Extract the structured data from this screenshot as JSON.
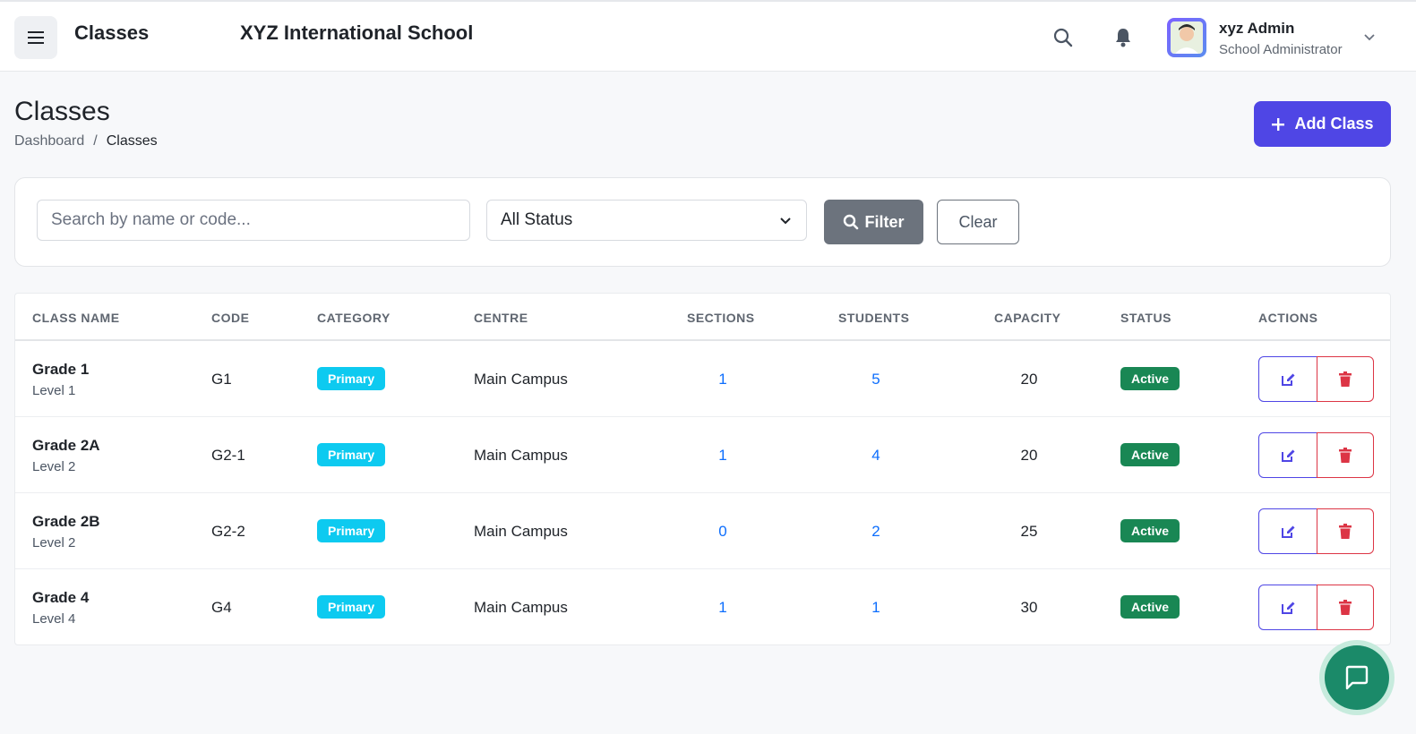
{
  "header": {
    "title": "Classes",
    "school_name": "XYZ International School",
    "user": {
      "name": "xyz Admin",
      "role": "School Administrator"
    }
  },
  "page": {
    "title": "Classes",
    "breadcrumb": [
      "Dashboard",
      "/",
      "Classes"
    ],
    "add_button_label": "Add Class"
  },
  "filters": {
    "search_placeholder": "Search by name or code...",
    "status_selected": "All Status",
    "filter_label": "Filter",
    "clear_label": "Clear"
  },
  "table": {
    "columns": [
      "CLASS NAME",
      "CODE",
      "CATEGORY",
      "CENTRE",
      "SECTIONS",
      "STUDENTS",
      "CAPACITY",
      "STATUS",
      "ACTIONS"
    ],
    "rows": [
      {
        "name": "Grade 1",
        "level": "Level 1",
        "code": "G1",
        "category": "Primary",
        "centre": "Main Campus",
        "sections": "1",
        "students": "5",
        "capacity": "20",
        "status": "Active"
      },
      {
        "name": "Grade 2A",
        "level": "Level 2",
        "code": "G2-1",
        "category": "Primary",
        "centre": "Main Campus",
        "sections": "1",
        "students": "4",
        "capacity": "20",
        "status": "Active"
      },
      {
        "name": "Grade 2B",
        "level": "Level 2",
        "code": "G2-2",
        "category": "Primary",
        "centre": "Main Campus",
        "sections": "0",
        "students": "2",
        "capacity": "25",
        "status": "Active"
      },
      {
        "name": "Grade 4",
        "level": "Level 4",
        "code": "G4",
        "category": "Primary",
        "centre": "Main Campus",
        "sections": "1",
        "students": "1",
        "capacity": "30",
        "status": "Active"
      }
    ]
  },
  "colors": {
    "primary": "#4f46e5",
    "category_badge": "#0dcaf0",
    "status_active": "#198754",
    "link": "#0d6efd",
    "danger": "#dc3545",
    "chat": "#1b8a69"
  },
  "icons": {
    "menu": "hamburger-icon",
    "search": "search-icon",
    "notifications": "bell-icon",
    "user_menu": "chevron-down-icon",
    "add": "plus-icon",
    "edit": "edit-icon",
    "delete": "trash-icon",
    "chat": "chat-icon"
  }
}
